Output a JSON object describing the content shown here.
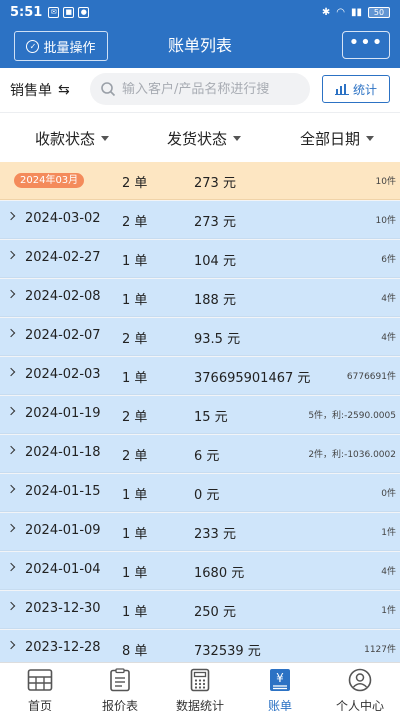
{
  "status": {
    "time": "5:51",
    "battery": "50"
  },
  "header": {
    "batch_label": "批量操作",
    "title": "账单列表",
    "more_label": "•••"
  },
  "search": {
    "type_label": "销售单",
    "placeholder": "输入客户/产品名称进行搜",
    "stat_label": "统计"
  },
  "filters": {
    "payment": "收款状态",
    "shipping": "发货状态",
    "date": "全部日期"
  },
  "month_row": {
    "tag": "2024年03月",
    "count": "2 单",
    "amount": "273 元",
    "note": "10件"
  },
  "rows": [
    {
      "date": "2024-03-02",
      "count": "2 单",
      "amount": "273 元",
      "note": "10件"
    },
    {
      "date": "2024-02-27",
      "count": "1 单",
      "amount": "104 元",
      "note": "6件"
    },
    {
      "date": "2024-02-08",
      "count": "1 单",
      "amount": "188 元",
      "note": "4件"
    },
    {
      "date": "2024-02-07",
      "count": "2 单",
      "amount": "93.5 元",
      "note": "4件"
    },
    {
      "date": "2024-02-03",
      "count": "1 单",
      "amount": "376695901467 元",
      "note": "6776691件"
    },
    {
      "date": "2024-01-19",
      "count": "2 单",
      "amount": "15 元",
      "note": "5件，利:-2590.0005"
    },
    {
      "date": "2024-01-18",
      "count": "2 单",
      "amount": "6 元",
      "note": "2件，利:-1036.0002"
    },
    {
      "date": "2024-01-15",
      "count": "1 单",
      "amount": "0 元",
      "note": "0件"
    },
    {
      "date": "2024-01-09",
      "count": "1 单",
      "amount": "233 元",
      "note": "1件"
    },
    {
      "date": "2024-01-04",
      "count": "1 单",
      "amount": "1680 元",
      "note": "4件"
    },
    {
      "date": "2023-12-30",
      "count": "1 单",
      "amount": "250 元",
      "note": "1件"
    },
    {
      "date": "2023-12-28",
      "count": "8 单",
      "amount": "732539 元",
      "note": "1127件"
    }
  ],
  "tabs": [
    {
      "label": "首页",
      "icon": "home-grid-icon"
    },
    {
      "label": "报价表",
      "icon": "clipboard-icon"
    },
    {
      "label": "数据统计",
      "icon": "calculator-icon"
    },
    {
      "label": "账单",
      "icon": "yen-bill-icon",
      "active": true
    },
    {
      "label": "个人中心",
      "icon": "user-icon"
    }
  ],
  "colors": {
    "primary": "#2c72c4",
    "row_bg": "#cfe5fa",
    "month_bg": "#fde6c2",
    "tag": "#f48b5b"
  }
}
